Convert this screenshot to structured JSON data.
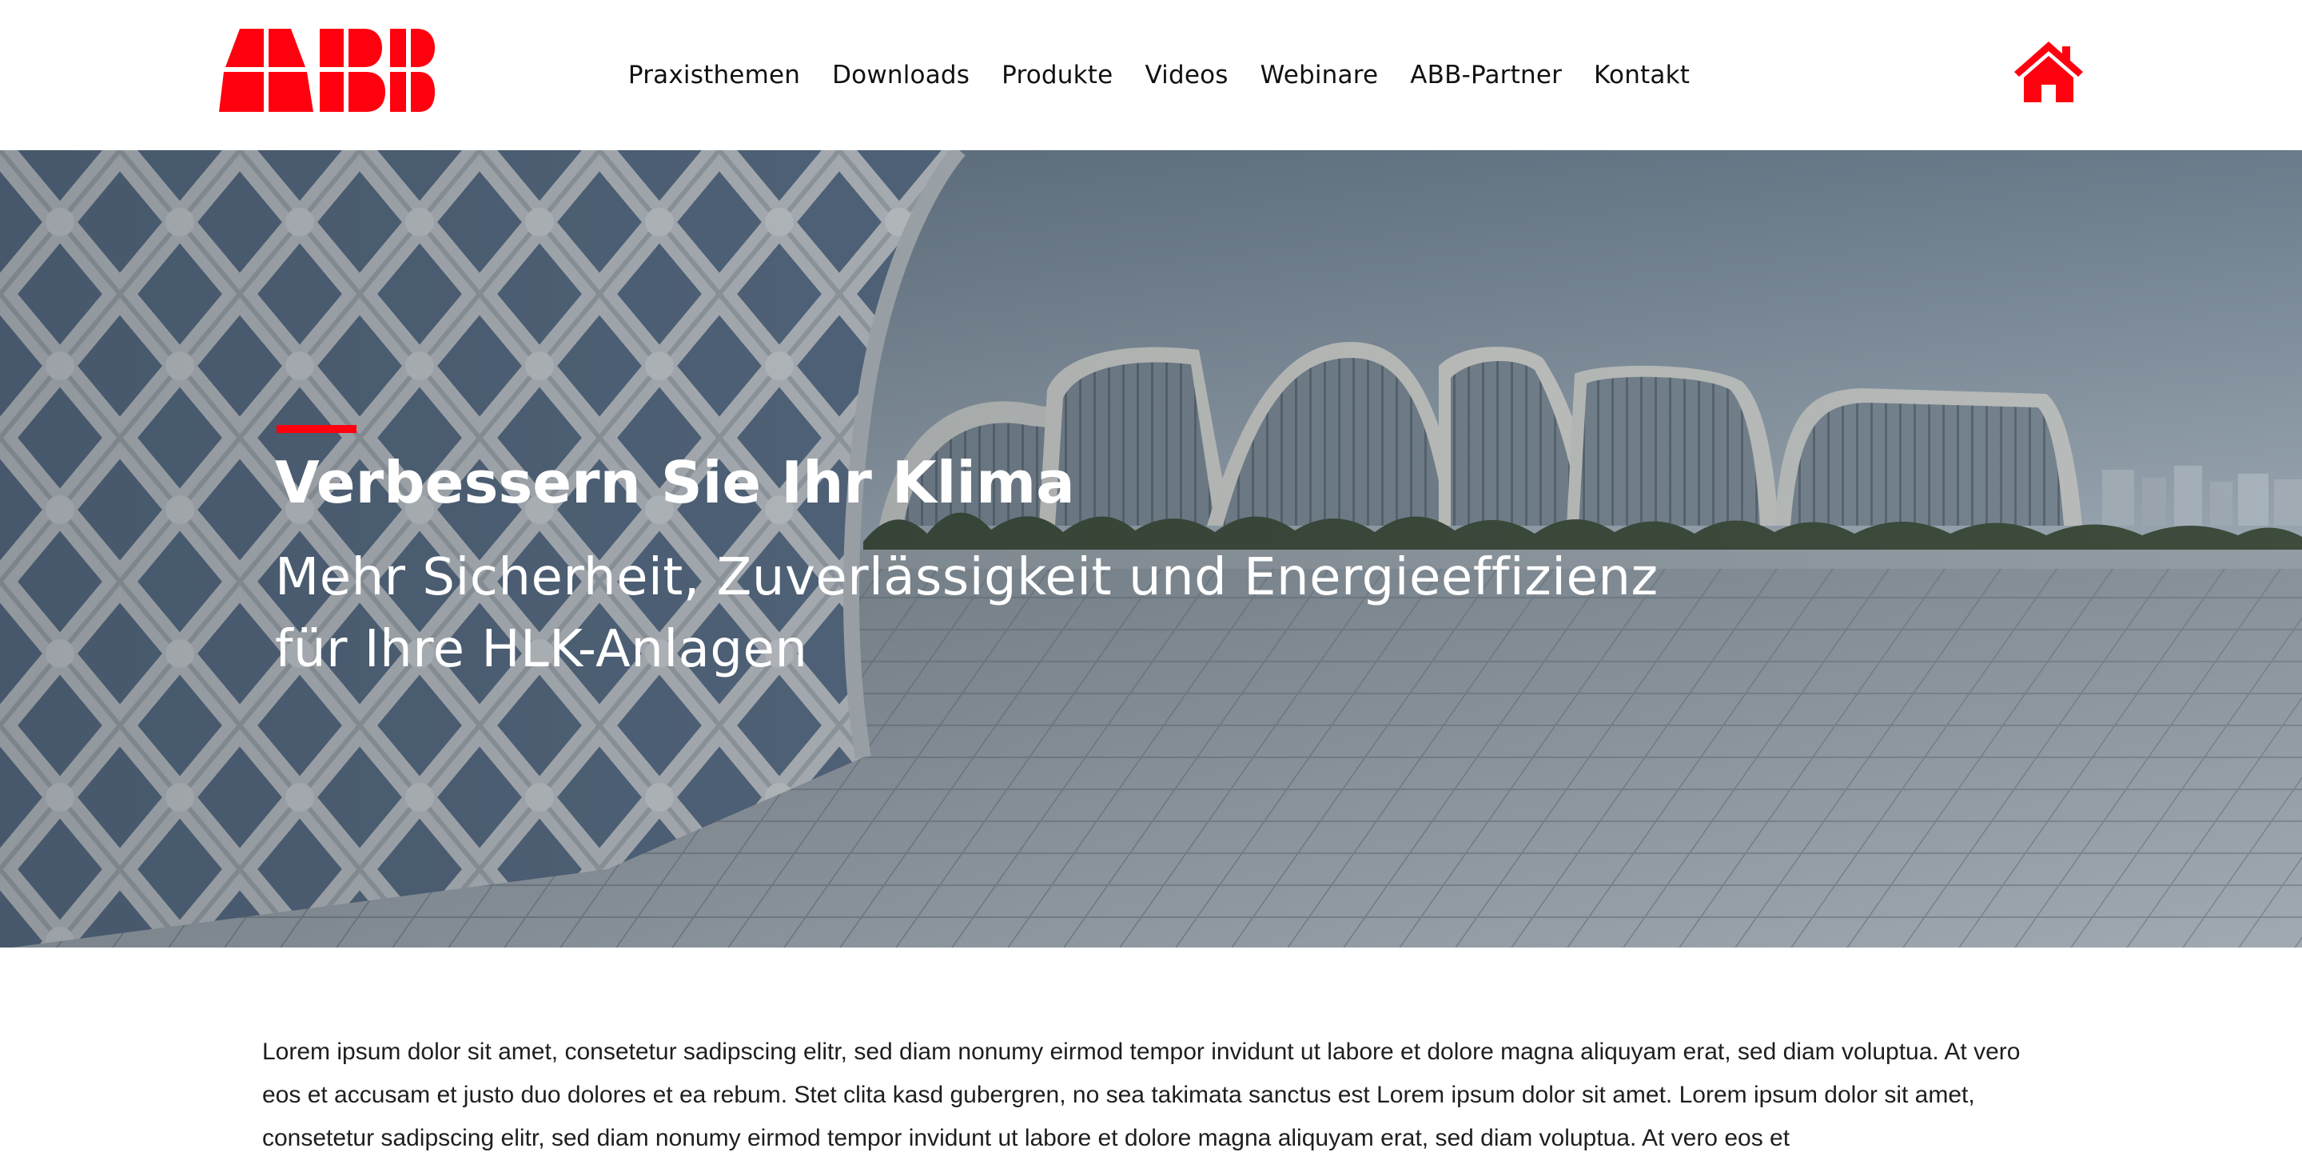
{
  "header": {
    "logo_text": "ABB",
    "nav": [
      {
        "label": "Praxisthemen"
      },
      {
        "label": "Downloads"
      },
      {
        "label": "Produkte"
      },
      {
        "label": "Videos"
      },
      {
        "label": "Webinare"
      },
      {
        "label": "ABB-Partner"
      },
      {
        "label": "Kontakt"
      }
    ],
    "home_icon": "home-icon"
  },
  "hero": {
    "title": "Verbessern Sie Ihr Klima",
    "subtitle_line1": "Mehr Sicherheit, Zuverlässigkeit und Energieeffizienz",
    "subtitle_line2": "für Ihre HLK-Anlagen"
  },
  "body": {
    "text": "Lorem ipsum dolor sit amet, consetetur sadipscing elitr, sed diam nonumy eirmod tempor invidunt ut labore et dolore magna aliquyam erat, sed diam voluptua. At vero eos et accusam et justo duo dolores et ea rebum. Stet clita kasd gubergren, no sea takimata sanctus est Lorem ipsum dolor sit amet. Lorem ipsum dolor sit amet, consetetur sadipscing elitr, sed diam nonumy eirmod tempor invidunt ut labore et dolore magna aliquyam erat, sed diam voluptua. At vero eos et"
  },
  "colors": {
    "brand_red": "#ff000f",
    "text": "#111111",
    "hero_text": "#ffffff"
  }
}
